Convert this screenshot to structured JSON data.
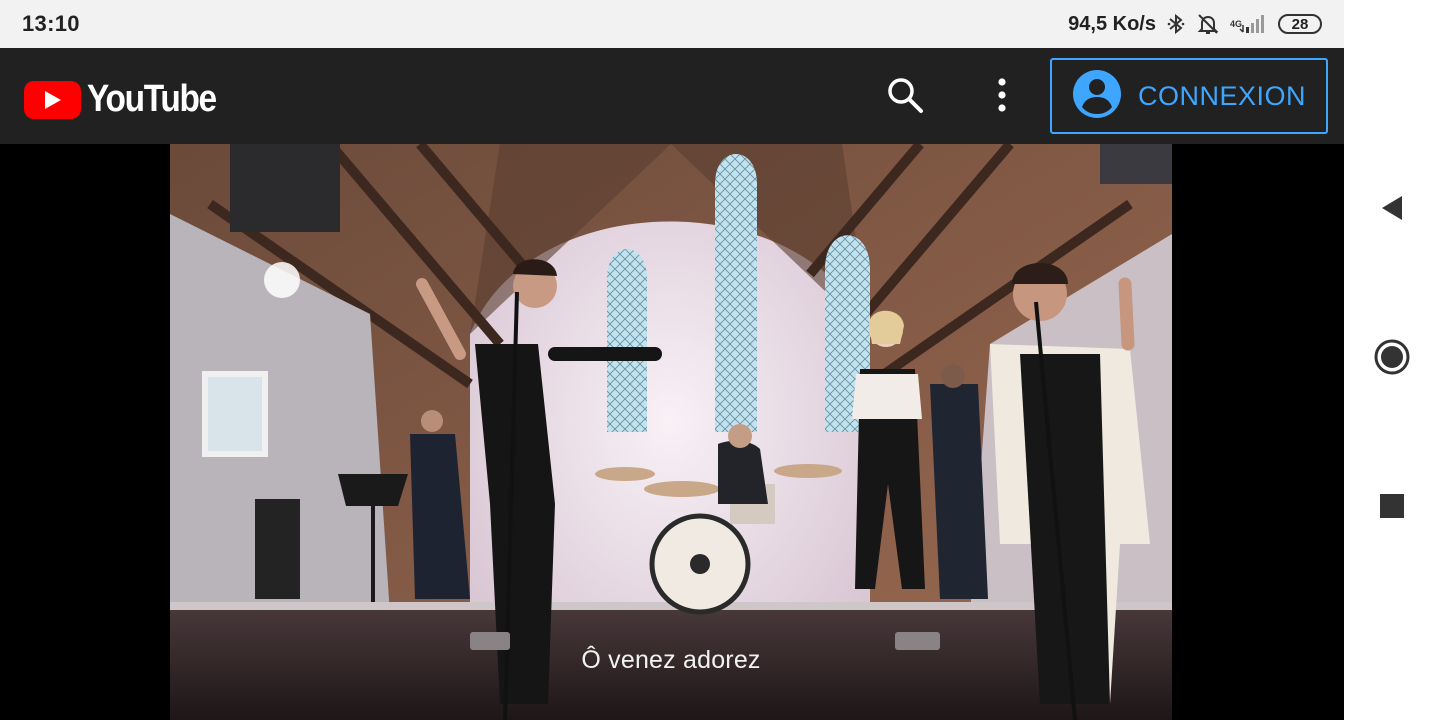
{
  "status_bar": {
    "time": "13:10",
    "network_speed": "94,5 Ko/s",
    "network_type": "4G",
    "battery": "28",
    "icons": [
      "bluetooth-icon",
      "bell-off-icon",
      "signal-icon",
      "battery-icon"
    ]
  },
  "youtube": {
    "brand": "YouTube",
    "sign_in_label": "CONNEXION",
    "icons": [
      "youtube-play-icon",
      "search-icon",
      "more-vert-icon",
      "account-icon"
    ],
    "accent_color": "#3ea6ff",
    "brand_color": "#ff0000"
  },
  "video": {
    "caption": "Ô venez adorez"
  },
  "nav_bar": {
    "icons": [
      "back-icon",
      "home-icon",
      "recents-icon"
    ]
  }
}
